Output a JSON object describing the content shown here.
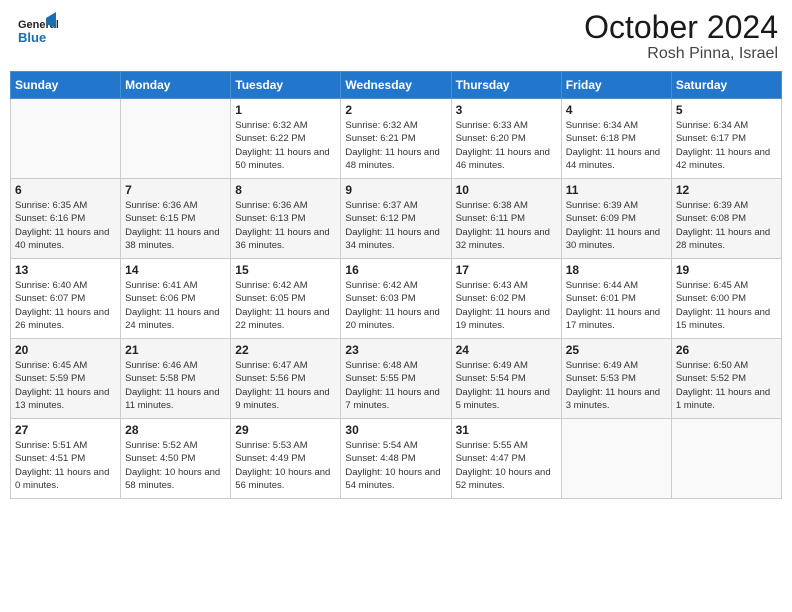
{
  "header": {
    "logo_text1": "General",
    "logo_text2": "Blue",
    "month": "October 2024",
    "location": "Rosh Pinna, Israel"
  },
  "weekdays": [
    "Sunday",
    "Monday",
    "Tuesday",
    "Wednesday",
    "Thursday",
    "Friday",
    "Saturday"
  ],
  "weeks": [
    [
      {
        "day": "",
        "info": ""
      },
      {
        "day": "",
        "info": ""
      },
      {
        "day": "1",
        "info": "Sunrise: 6:32 AM\nSunset: 6:22 PM\nDaylight: 11 hours and 50 minutes."
      },
      {
        "day": "2",
        "info": "Sunrise: 6:32 AM\nSunset: 6:21 PM\nDaylight: 11 hours and 48 minutes."
      },
      {
        "day": "3",
        "info": "Sunrise: 6:33 AM\nSunset: 6:20 PM\nDaylight: 11 hours and 46 minutes."
      },
      {
        "day": "4",
        "info": "Sunrise: 6:34 AM\nSunset: 6:18 PM\nDaylight: 11 hours and 44 minutes."
      },
      {
        "day": "5",
        "info": "Sunrise: 6:34 AM\nSunset: 6:17 PM\nDaylight: 11 hours and 42 minutes."
      }
    ],
    [
      {
        "day": "6",
        "info": "Sunrise: 6:35 AM\nSunset: 6:16 PM\nDaylight: 11 hours and 40 minutes."
      },
      {
        "day": "7",
        "info": "Sunrise: 6:36 AM\nSunset: 6:15 PM\nDaylight: 11 hours and 38 minutes."
      },
      {
        "day": "8",
        "info": "Sunrise: 6:36 AM\nSunset: 6:13 PM\nDaylight: 11 hours and 36 minutes."
      },
      {
        "day": "9",
        "info": "Sunrise: 6:37 AM\nSunset: 6:12 PM\nDaylight: 11 hours and 34 minutes."
      },
      {
        "day": "10",
        "info": "Sunrise: 6:38 AM\nSunset: 6:11 PM\nDaylight: 11 hours and 32 minutes."
      },
      {
        "day": "11",
        "info": "Sunrise: 6:39 AM\nSunset: 6:09 PM\nDaylight: 11 hours and 30 minutes."
      },
      {
        "day": "12",
        "info": "Sunrise: 6:39 AM\nSunset: 6:08 PM\nDaylight: 11 hours and 28 minutes."
      }
    ],
    [
      {
        "day": "13",
        "info": "Sunrise: 6:40 AM\nSunset: 6:07 PM\nDaylight: 11 hours and 26 minutes."
      },
      {
        "day": "14",
        "info": "Sunrise: 6:41 AM\nSunset: 6:06 PM\nDaylight: 11 hours and 24 minutes."
      },
      {
        "day": "15",
        "info": "Sunrise: 6:42 AM\nSunset: 6:05 PM\nDaylight: 11 hours and 22 minutes."
      },
      {
        "day": "16",
        "info": "Sunrise: 6:42 AM\nSunset: 6:03 PM\nDaylight: 11 hours and 20 minutes."
      },
      {
        "day": "17",
        "info": "Sunrise: 6:43 AM\nSunset: 6:02 PM\nDaylight: 11 hours and 19 minutes."
      },
      {
        "day": "18",
        "info": "Sunrise: 6:44 AM\nSunset: 6:01 PM\nDaylight: 11 hours and 17 minutes."
      },
      {
        "day": "19",
        "info": "Sunrise: 6:45 AM\nSunset: 6:00 PM\nDaylight: 11 hours and 15 minutes."
      }
    ],
    [
      {
        "day": "20",
        "info": "Sunrise: 6:45 AM\nSunset: 5:59 PM\nDaylight: 11 hours and 13 minutes."
      },
      {
        "day": "21",
        "info": "Sunrise: 6:46 AM\nSunset: 5:58 PM\nDaylight: 11 hours and 11 minutes."
      },
      {
        "day": "22",
        "info": "Sunrise: 6:47 AM\nSunset: 5:56 PM\nDaylight: 11 hours and 9 minutes."
      },
      {
        "day": "23",
        "info": "Sunrise: 6:48 AM\nSunset: 5:55 PM\nDaylight: 11 hours and 7 minutes."
      },
      {
        "day": "24",
        "info": "Sunrise: 6:49 AM\nSunset: 5:54 PM\nDaylight: 11 hours and 5 minutes."
      },
      {
        "day": "25",
        "info": "Sunrise: 6:49 AM\nSunset: 5:53 PM\nDaylight: 11 hours and 3 minutes."
      },
      {
        "day": "26",
        "info": "Sunrise: 6:50 AM\nSunset: 5:52 PM\nDaylight: 11 hours and 1 minute."
      }
    ],
    [
      {
        "day": "27",
        "info": "Sunrise: 5:51 AM\nSunset: 4:51 PM\nDaylight: 11 hours and 0 minutes."
      },
      {
        "day": "28",
        "info": "Sunrise: 5:52 AM\nSunset: 4:50 PM\nDaylight: 10 hours and 58 minutes."
      },
      {
        "day": "29",
        "info": "Sunrise: 5:53 AM\nSunset: 4:49 PM\nDaylight: 10 hours and 56 minutes."
      },
      {
        "day": "30",
        "info": "Sunrise: 5:54 AM\nSunset: 4:48 PM\nDaylight: 10 hours and 54 minutes."
      },
      {
        "day": "31",
        "info": "Sunrise: 5:55 AM\nSunset: 4:47 PM\nDaylight: 10 hours and 52 minutes."
      },
      {
        "day": "",
        "info": ""
      },
      {
        "day": "",
        "info": ""
      }
    ]
  ]
}
